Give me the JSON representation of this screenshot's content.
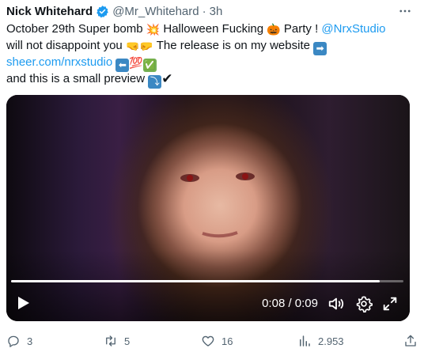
{
  "tweet": {
    "author_name": "Nick Whitehard",
    "handle": "@Mr_Whitehard",
    "separator": "·",
    "time": "3h",
    "text": {
      "l1_a": "October 29th Super bomb ",
      "l1_b": " Halloween Fucking ",
      "l1_c": " Party ! ",
      "l1_mention": "@NrxStudio",
      "l2_a": "will not disappoint you ",
      "l2_b": " The release is on my website ",
      "l3_link": "sheer.com/nrxstudio",
      "l4_a": " and this is a small preview "
    },
    "emoji": {
      "bomb": "💥",
      "pumpkin": "🎃",
      "fists": "🤜🤛",
      "arrow_right": "➡",
      "arrow_left": "⬅",
      "hundred": "💯",
      "check_box": "✅",
      "turn_down": "⤵",
      "check": "✔"
    }
  },
  "video": {
    "timecode": "0:08 / 0:09",
    "progress_fraction": 0.94
  },
  "actions": {
    "replies": "3",
    "retweets": "5",
    "likes": "16",
    "views": "2.953"
  },
  "colors": {
    "accent": "#1d9bf0",
    "muted": "#536471",
    "verified": "#1d9bf0"
  },
  "icons": [
    "verified-badge-icon",
    "more-icon",
    "play-icon",
    "volume-icon",
    "settings-icon",
    "fullscreen-icon",
    "reply-icon",
    "retweet-icon",
    "like-icon",
    "views-icon",
    "share-icon"
  ]
}
